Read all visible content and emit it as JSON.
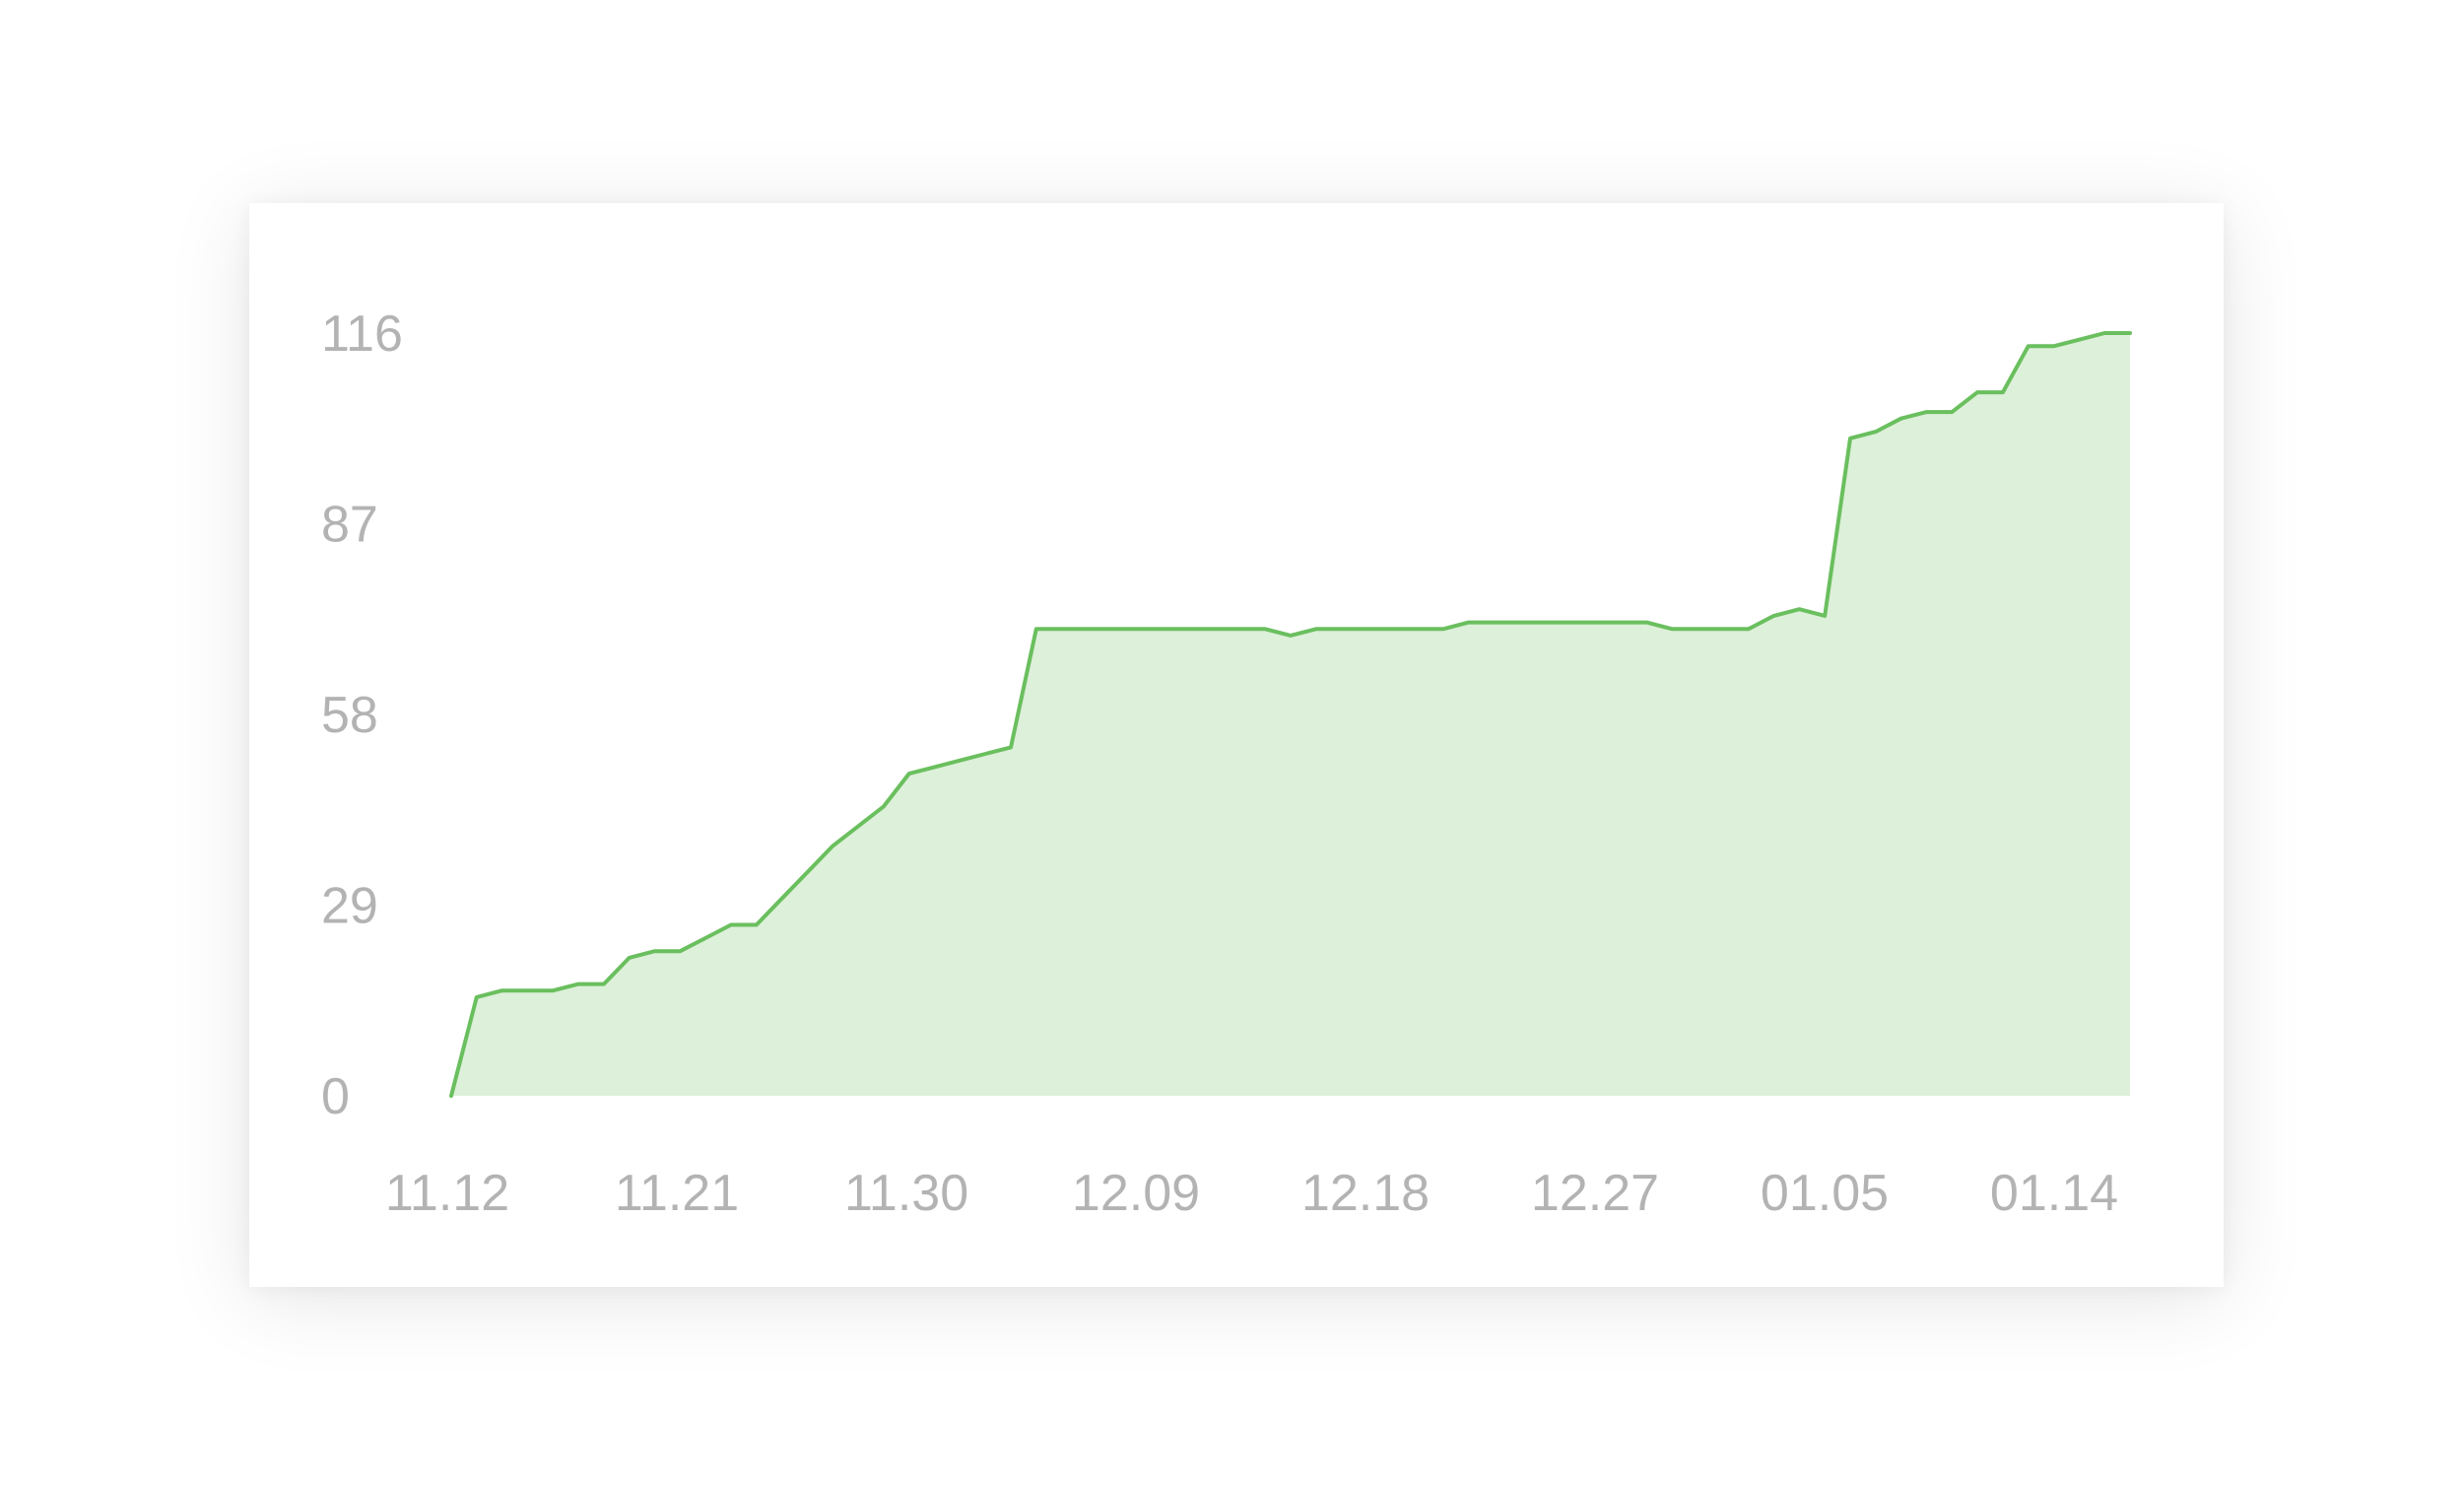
{
  "chart_data": {
    "type": "area",
    "title": "",
    "xlabel": "",
    "ylabel": "",
    "ylim": [
      0,
      116
    ],
    "y_ticks": [
      "0",
      "29",
      "58",
      "87",
      "116"
    ],
    "x_tick_labels": [
      "11.12",
      "11.21",
      "11.30",
      "12.09",
      "12.18",
      "12.27",
      "01.05",
      "01.14"
    ],
    "grid": false,
    "legend": "none",
    "line_color": "#6abf5e",
    "fill_color": "#ddf0d9",
    "series": [
      {
        "x": [
          0,
          1,
          2,
          3,
          4,
          5,
          6,
          7,
          8,
          9,
          10,
          11,
          12,
          13,
          14,
          15,
          16,
          17,
          18,
          19,
          20,
          21,
          22,
          23,
          24,
          25,
          26,
          27,
          28,
          29,
          30,
          31,
          32,
          33,
          34,
          35,
          36,
          37,
          38,
          39,
          40,
          41,
          42,
          43,
          44,
          45,
          46,
          47,
          48,
          49,
          50,
          51,
          52,
          53,
          54,
          55,
          56,
          57,
          58,
          59,
          60,
          61,
          62,
          63,
          64,
          65,
          66
        ],
        "values": [
          0,
          15,
          16,
          16,
          16,
          17,
          17,
          21,
          22,
          22,
          24,
          26,
          26,
          30,
          34,
          38,
          41,
          44,
          49,
          50,
          51,
          52,
          53,
          71,
          71,
          71,
          71,
          71,
          71,
          71,
          71,
          71,
          71,
          70,
          71,
          71,
          71,
          71,
          71,
          71,
          72,
          72,
          72,
          72,
          72,
          72,
          72,
          72,
          71,
          71,
          71,
          71,
          73,
          74,
          73,
          100,
          101,
          103,
          104,
          104,
          107,
          107,
          114,
          114,
          115,
          116,
          116
        ]
      }
    ]
  }
}
